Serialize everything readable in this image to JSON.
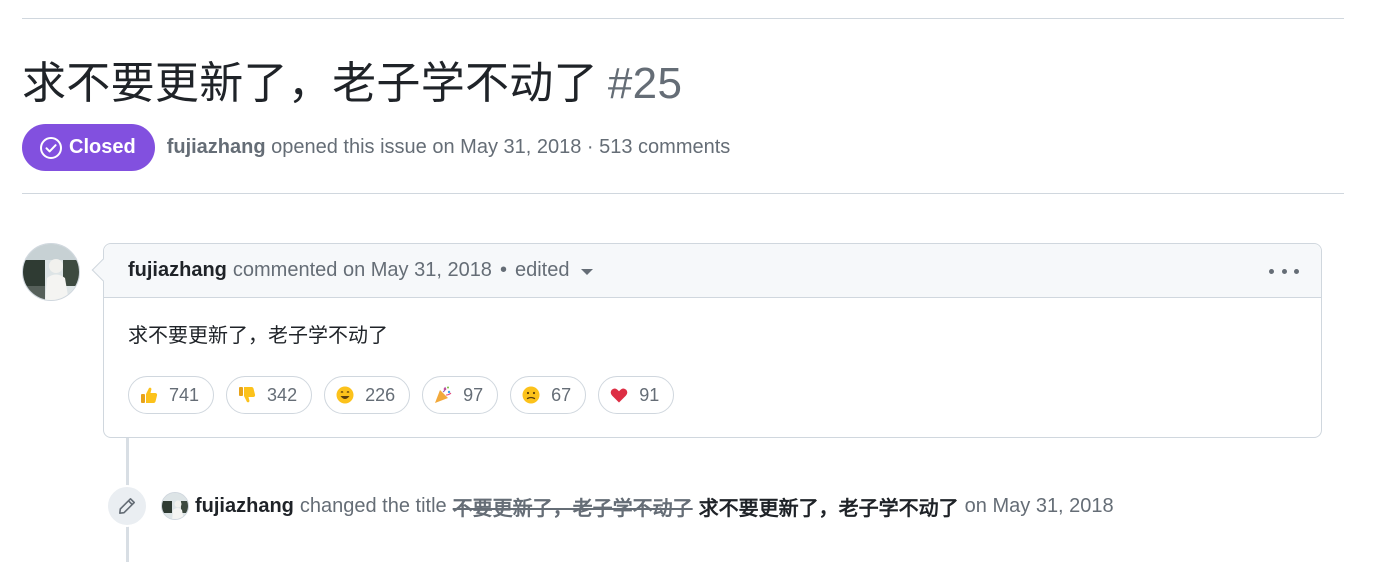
{
  "issue": {
    "title": "求不要更新了，老子学不动了",
    "number": "#25",
    "state_label": "Closed",
    "author": "fujiazhang",
    "opened_text": "opened this issue on May 31, 2018 · 513 comments"
  },
  "comment": {
    "author": "fujiazhang",
    "commented_text": "commented on May 31, 2018",
    "separator": "•",
    "edited_label": "edited",
    "body": "求不要更新了，老子学不动了",
    "reactions": [
      {
        "icon": "thumbs-up-icon",
        "count": "741"
      },
      {
        "icon": "thumbs-down-icon",
        "count": "342"
      },
      {
        "icon": "laugh-icon",
        "count": "226"
      },
      {
        "icon": "hooray-icon",
        "count": "97"
      },
      {
        "icon": "confused-icon",
        "count": "67"
      },
      {
        "icon": "heart-icon",
        "count": "91"
      }
    ]
  },
  "event": {
    "author": "fujiazhang",
    "action_text": "changed the title",
    "old_title": "不要更新了，老子学不动了",
    "new_title": "求不要更新了，老子学不动了",
    "date_text": "on May 31, 2018"
  },
  "colors": {
    "closed_badge": "#8250df",
    "muted_text": "#656d76",
    "border": "#d0d7de"
  }
}
